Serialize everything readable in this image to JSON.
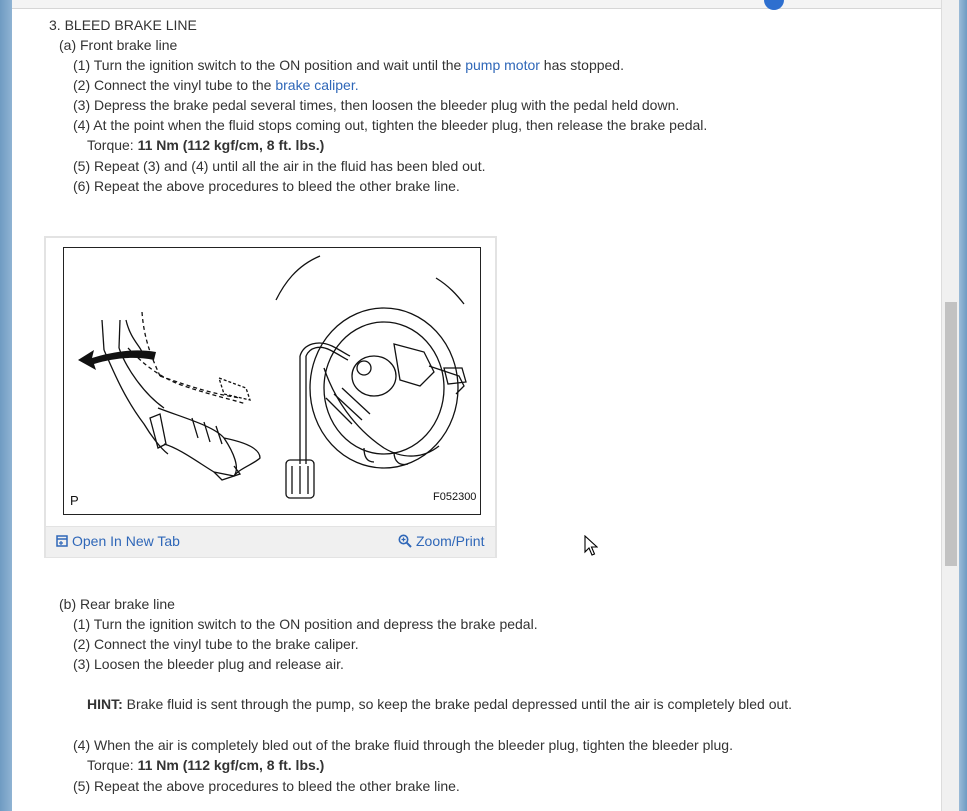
{
  "section": {
    "title": "3. BLEED BRAKE LINE",
    "front": {
      "heading": "(a) Front brake line",
      "step1_pre": "(1) Turn the ignition switch to the ON position and wait until the ",
      "step1_link": "pump motor",
      "step1_post": " has stopped.",
      "step2_pre": "(2) Connect the vinyl tube to the ",
      "step2_link": "brake caliper.",
      "step3": "(3) Depress the brake pedal several times, then loosen the bleeder plug with the pedal held down.",
      "step4": "(4) At the point when the fluid stops coming out, tighten the bleeder plug, then release the brake pedal.",
      "torque_label": "Torque: ",
      "torque_value": "11 Nm (112 kgf/cm, 8 ft. lbs.)",
      "step5": "(5) Repeat (3) and (4) until all the air in the fluid has been bled out.",
      "step6": "(6) Repeat the above procedures to bleed the other brake line."
    },
    "figure": {
      "letter": "P",
      "code": "F052300",
      "open_label": "Open In New Tab",
      "zoom_label": "Zoom/Print"
    },
    "rear": {
      "heading": "(b) Rear brake line",
      "step1": "(1) Turn the ignition switch to the ON position and depress the brake pedal.",
      "step2": "(2) Connect the vinyl tube to the brake caliper.",
      "step3": "(3) Loosen the bleeder plug and release air.",
      "hint_label": "HINT:",
      "hint_text": " Brake fluid is sent through the pump, so keep the brake pedal depressed until the air is completely bled out.",
      "step4": "(4) When the air is completely bled out of the brake fluid through the bleeder plug, tighten the bleeder plug.",
      "torque_label": "Torque: ",
      "torque_value": "11 Nm (112 kgf/cm, 8 ft. lbs.)",
      "step5": "(5) Repeat the above procedures to bleed the other brake line."
    }
  },
  "icons": {
    "open": "open-new-tab-icon",
    "zoom": "zoom-magnifier-icon",
    "cursor": "mouse-pointer-icon"
  },
  "colors": {
    "link": "#2f67b8",
    "background": "#7fa7c9"
  }
}
